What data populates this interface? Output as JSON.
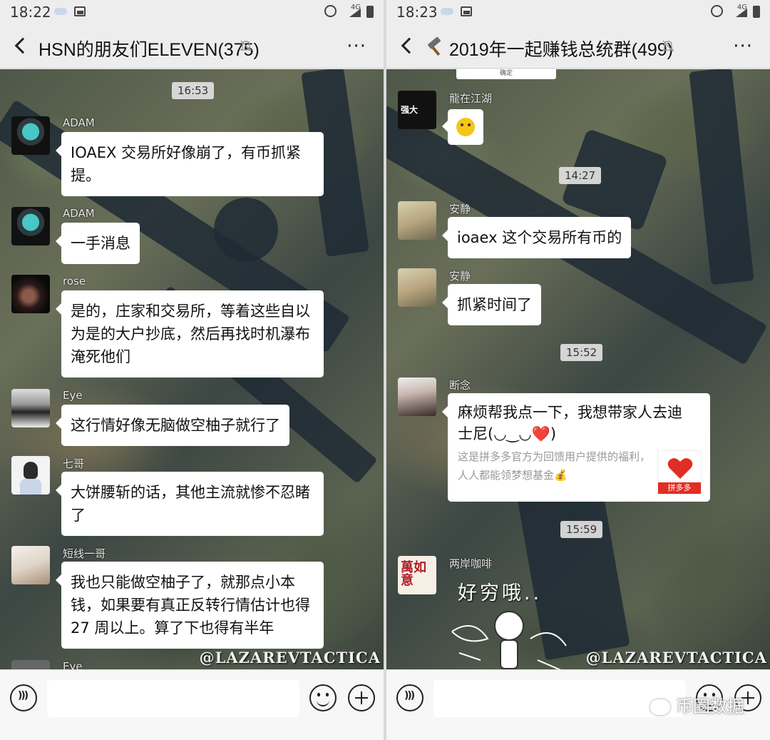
{
  "left": {
    "status": {
      "time": "18:22",
      "network": "4G"
    },
    "title": "HSN的朋友们ELEVEN(375)",
    "watermark": "@LAZAREVTACTICA",
    "timestamp": "16:53",
    "messages": [
      {
        "sender": "ADAM",
        "text": "IOAEX 交易所好像崩了，有币抓紧提。"
      },
      {
        "sender": "ADAM",
        "text": "一手消息"
      },
      {
        "sender": "rose",
        "text": "是的，庄家和交易所，等着这些自以为是的大户抄底，然后再找时机瀑布淹死他们"
      },
      {
        "sender": "Eye",
        "text": "这行情好像无脑做空柚子就行了"
      },
      {
        "sender": "七哥",
        "text": "大饼腰斩的话，其他主流就惨不忍睹了"
      },
      {
        "sender": "短线一哥",
        "text": "我也只能做空柚子了，就那点小本钱，如果要有真正反转行情估计也得 27 周以上。算了下也得有半年"
      },
      {
        "sender": "Eye",
        "text": ""
      }
    ]
  },
  "right": {
    "status": {
      "time": "18:23",
      "network": "4G"
    },
    "title_icon": "hammer-icon",
    "title": "2019年一起赚钱总统群(499)",
    "watermark": "@LAZAREVTACTICA",
    "top_button": "确定",
    "messages": [
      {
        "sender": "龍在江湖",
        "avatar_text": "强大",
        "type": "sticker"
      },
      {
        "timestamp": "14:27"
      },
      {
        "sender": "安静",
        "text": "ioaex 这个交易所有币的"
      },
      {
        "sender": "安静",
        "text": "抓紧时间了"
      },
      {
        "timestamp": "15:52"
      },
      {
        "sender": "断念",
        "type": "card",
        "card_title": "麻烦帮我点一下，我想带家人去迪士尼(◡‿◡❤️)",
        "card_desc": "这是拼多多官方为回馈用户提供的福利，人人都能领梦想基金💰",
        "card_brand": "拼多多"
      },
      {
        "timestamp": "15:59"
      },
      {
        "sender": "两岸咖啡",
        "avatar_text": "萬如意",
        "type": "image-sticker",
        "sticker_text": "好穷哦.."
      }
    ]
  },
  "brandmark": "币圈数据"
}
